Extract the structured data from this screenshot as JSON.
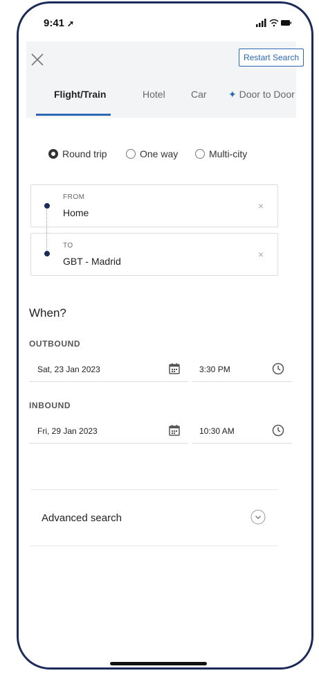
{
  "status_bar": {
    "time": "9:41",
    "location_arrow": "➚",
    "indicators": "signal-wifi-battery"
  },
  "header": {
    "close_icon": "close-icon",
    "restart_label": "Restart Search"
  },
  "tabs": [
    {
      "label": "Flight/Train",
      "active": true
    },
    {
      "label": "Hotel",
      "active": false
    },
    {
      "label": "Car",
      "active": false
    },
    {
      "label": "Door to Door",
      "active": false,
      "icon": "sparkle-icon"
    }
  ],
  "trip_types": [
    {
      "label": "Round trip",
      "selected": true
    },
    {
      "label": "One way",
      "selected": false
    },
    {
      "label": "Multi-city",
      "selected": false
    }
  ],
  "from": {
    "label": "FROM",
    "value": "Home",
    "clear": "×"
  },
  "to": {
    "label": "TO",
    "value": "GBT - Madrid",
    "clear": "×"
  },
  "when": {
    "title": "When?",
    "outbound": {
      "label": "OUTBOUND",
      "date": "Sat, 23 Jan 2023",
      "time": "3:30 PM"
    },
    "inbound": {
      "label": "INBOUND",
      "date": "Fri, 29 Jan 2023",
      "time": "10:30 AM"
    }
  },
  "advanced": {
    "label": "Advanced search"
  },
  "colors": {
    "accent": "#2b67b2",
    "frame": "#1b2a57"
  }
}
